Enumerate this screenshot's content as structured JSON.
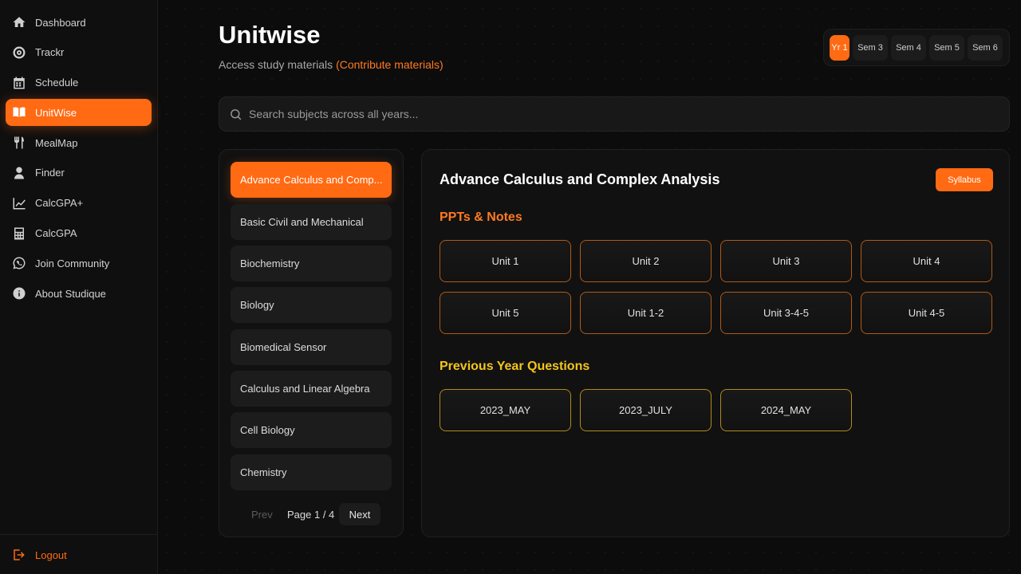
{
  "sidebar": {
    "items": [
      {
        "label": "Dashboard",
        "icon": "home-icon",
        "active": false
      },
      {
        "label": "Trackr",
        "icon": "target-icon",
        "active": false
      },
      {
        "label": "Schedule",
        "icon": "calendar-icon",
        "active": false
      },
      {
        "label": "UnitWise",
        "icon": "book-icon",
        "active": true
      },
      {
        "label": "MealMap",
        "icon": "utensils-icon",
        "active": false
      },
      {
        "label": "Finder",
        "icon": "user-icon",
        "active": false
      },
      {
        "label": "CalcGPA+",
        "icon": "chart-line-icon",
        "active": false
      },
      {
        "label": "CalcGPA",
        "icon": "calculator-icon",
        "active": false
      },
      {
        "label": "Join Community",
        "icon": "whatsapp-icon",
        "active": false
      },
      {
        "label": "About Studique",
        "icon": "info-icon",
        "active": false
      }
    ],
    "logout_label": "Logout"
  },
  "header": {
    "title": "Unitwise",
    "subtitle": "Access study materials",
    "contribute_link": "(Contribute materials)"
  },
  "semesters": [
    {
      "label": "Yr 1",
      "active": true
    },
    {
      "label": "Sem 3",
      "active": false
    },
    {
      "label": "Sem 4",
      "active": false
    },
    {
      "label": "Sem 5",
      "active": false
    },
    {
      "label": "Sem 6",
      "active": false
    }
  ],
  "search": {
    "placeholder": "Search subjects across all years..."
  },
  "subjects": [
    {
      "label": "Advance Calculus and Comp...",
      "active": true
    },
    {
      "label": "Basic Civil and Mechanical",
      "active": false
    },
    {
      "label": "Biochemistry",
      "active": false
    },
    {
      "label": "Biology",
      "active": false
    },
    {
      "label": "Biomedical Sensor",
      "active": false
    },
    {
      "label": "Calculus and Linear Algebra",
      "active": false
    },
    {
      "label": "Cell Biology",
      "active": false
    },
    {
      "label": "Chemistry",
      "active": false
    }
  ],
  "pager": {
    "prev": "Prev",
    "info": "Page 1 / 4",
    "next": "Next"
  },
  "detail": {
    "title": "Advance Calculus and Complex Analysis",
    "syllabus_label": "Syllabus",
    "notes_heading": "PPTs & Notes",
    "units": [
      "Unit 1",
      "Unit 2",
      "Unit 3",
      "Unit 4",
      "Unit 5",
      "Unit 1-2",
      "Unit 3-4-5",
      "Unit 4-5"
    ],
    "pyq_heading": "Previous Year Questions",
    "pyqs": [
      "2023_MAY",
      "2023_JULY",
      "2024_MAY"
    ]
  },
  "colors": {
    "accent": "#ff6a13",
    "pyq_heading": "#f3c51b",
    "background": "#0c0c0c"
  }
}
